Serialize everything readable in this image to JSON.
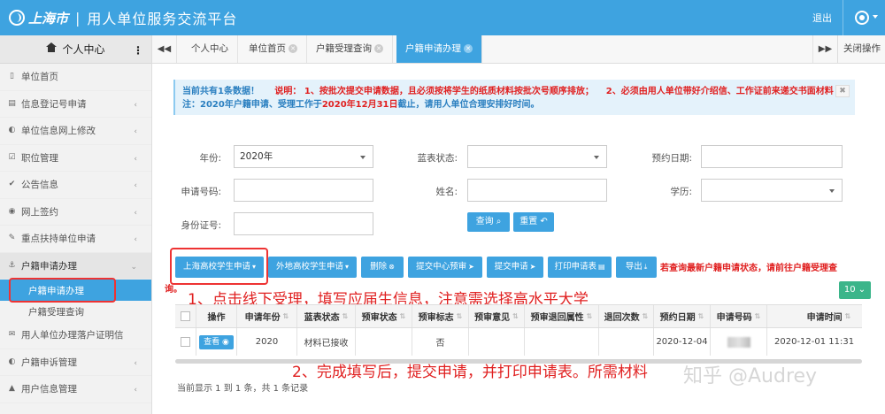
{
  "header": {
    "logo_city": "上海市",
    "title": "用人单位服务交流平台",
    "logout": "退出"
  },
  "sidebar": {
    "title": "个人中心",
    "items": [
      {
        "label": "单位首页",
        "icon": "bookmark-icon"
      },
      {
        "label": "信息登记号申请",
        "icon": "copy-icon"
      },
      {
        "label": "单位信息网上修改",
        "icon": "half-circle-icon"
      },
      {
        "label": "职位管理",
        "icon": "checkbox-icon"
      },
      {
        "label": "公告信息",
        "icon": "check-icon"
      },
      {
        "label": "网上签约",
        "icon": "eye-icon"
      },
      {
        "label": "重点扶持单位申请",
        "icon": "pencil-icon"
      },
      {
        "label": "户籍申请办理",
        "icon": "anchor-icon"
      },
      {
        "label": "用人单位办理落户证明信",
        "icon": "envelope-icon"
      },
      {
        "label": "户籍申诉管理",
        "icon": "half-circle-icon"
      },
      {
        "label": "用户信息管理",
        "icon": "bell-icon"
      }
    ],
    "sub_items": [
      {
        "label": "户籍申请办理"
      },
      {
        "label": "户籍受理查询"
      }
    ]
  },
  "tabs": {
    "items": [
      {
        "label": "个人中心"
      },
      {
        "label": "单位首页"
      },
      {
        "label": "户籍受理查询"
      },
      {
        "label": "户籍申请办理"
      }
    ],
    "close_ops": "关闭操作"
  },
  "notice": {
    "count_text": "当前共有1条数据！",
    "line1_label": "说明：",
    "line1_text": "1、按批次提交申请数据，且必须按将学生的纸质材料按批次号顺序排放；",
    "line1_text2": "2、必须由用人单位带好介绍信、工作证前来递交书面材料",
    "line2_text": "注：2020年户籍申请、受理工作于",
    "line2_date": "2020年12月31日",
    "line2_end": "截止，请用人单位合理安排好时间。"
  },
  "form": {
    "year_label": "年份:",
    "year_value": "2020年",
    "status_label": "蓝表状态:",
    "date_label": "预约日期:",
    "app_no_label": "申请号码:",
    "name_label": "姓名:",
    "edu_label": "学历:",
    "id_label": "身份证号:",
    "query_btn": "查询",
    "reset_btn": "重置"
  },
  "toolbar": {
    "btn_local": "上海高校学生申请",
    "btn_nonlocal": "外地高校学生申请",
    "btn_delete": "删除",
    "btn_submit_center": "提交中心预审",
    "btn_submit": "提交申请",
    "btn_print": "打印申请表",
    "btn_export": "导出",
    "note_a": "若查询最新户籍申请状态，请前往户籍受理查",
    "note_b": "询。",
    "page_size": "10"
  },
  "annotations": {
    "step1": "1、点击线下受理，填写应届生信息，注意需选择高水平大学",
    "step2": "2、完成填写后，提交申请，并打印申请表。所需材料"
  },
  "table": {
    "columns": [
      "操作",
      "申请年份",
      "蓝表状态",
      "预审状态",
      "预审标志",
      "预审意见",
      "预审退回属性",
      "退回次数",
      "预约日期",
      "申请号码",
      "申请时间"
    ],
    "rows": [
      {
        "action": "查看",
        "year": "2020",
        "status": "材料已接收",
        "pre_status": "",
        "pre_flag": "否",
        "pre_opinion": "",
        "return_attr": "",
        "return_count": "",
        "appt_date": "2020-12-04",
        "app_no": "",
        "app_time": "2020-12-01 11:31"
      }
    ],
    "footer": "当前显示 1 到 1 条，共 1 条记录"
  },
  "watermark": "知乎 @Audrey",
  "colors": {
    "primary": "#3ea3e0",
    "alert_red": "#e02020",
    "notice_bg": "#e4f2fb",
    "green": "#3bb58a"
  }
}
